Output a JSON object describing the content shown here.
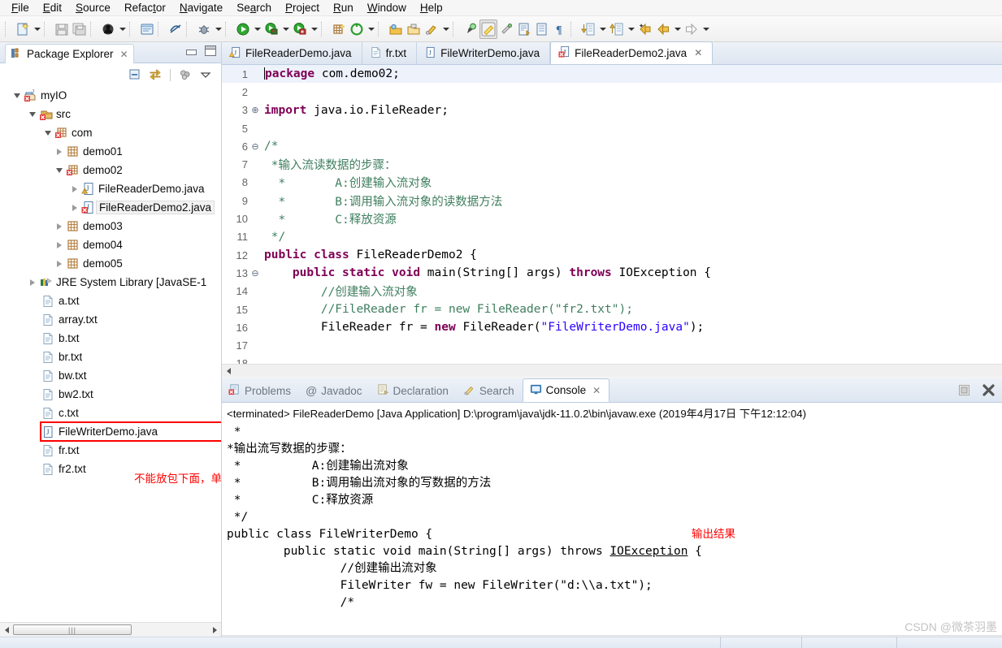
{
  "menubar": {
    "items": [
      {
        "label": "File",
        "mnemonic": "F"
      },
      {
        "label": "Edit",
        "mnemonic": "E"
      },
      {
        "label": "Source",
        "mnemonic": "S"
      },
      {
        "label": "Refactor",
        "mnemonic": "t"
      },
      {
        "label": "Navigate",
        "mnemonic": "N"
      },
      {
        "label": "Search",
        "mnemonic": "a"
      },
      {
        "label": "Project",
        "mnemonic": "P"
      },
      {
        "label": "Run",
        "mnemonic": "R"
      },
      {
        "label": "Window",
        "mnemonic": "W"
      },
      {
        "label": "Help",
        "mnemonic": "H"
      }
    ]
  },
  "toolbar": {
    "icons": [
      "new-wizard-icon",
      "save-icon",
      "save-all-icon",
      "print-icon",
      "new-java-class-icon",
      "toggle-mark-occurrences-icon",
      "debug-icon",
      "run-icon",
      "run-last-tool-icon",
      "coverage-icon",
      "new-java-project-icon",
      "external-tools-icon",
      "open-type-icon",
      "open-task-icon",
      "link-icon",
      "search-icon",
      "highlight-icon",
      "annotation-icon",
      "next-annotation-icon",
      "previous-annotation-icon",
      "pilcrow-icon",
      "next-edit-icon",
      "previous-edit-icon",
      "back-icon",
      "back-history-icon",
      "forward-icon"
    ]
  },
  "package_explorer": {
    "title": "Package Explorer",
    "close_glyph": "✕",
    "toolbar_icons": [
      "collapse-all-icon",
      "link-with-editor-icon",
      "view-menu-icon",
      "chevron-down-icon"
    ],
    "tree": [
      {
        "label": "myIO",
        "depth": 0,
        "twist": "open",
        "icon": "java-project-error-icon"
      },
      {
        "label": "src",
        "depth": 1,
        "twist": "open",
        "icon": "source-folder-error-icon"
      },
      {
        "label": "com",
        "depth": 2,
        "twist": "open",
        "icon": "package-error-icon"
      },
      {
        "label": "demo01",
        "depth": 3,
        "twist": "closed",
        "icon": "package-icon"
      },
      {
        "label": "demo02",
        "depth": 3,
        "twist": "open",
        "icon": "package-error-icon"
      },
      {
        "label": "FileReaderDemo.java",
        "depth": 4,
        "twist": "closed",
        "icon": "java-file-warning-icon"
      },
      {
        "label": "FileReaderDemo2.java",
        "depth": 4,
        "twist": "closed",
        "icon": "java-file-error-icon",
        "selected": true
      },
      {
        "label": "demo03",
        "depth": 3,
        "twist": "closed",
        "icon": "package-icon"
      },
      {
        "label": "demo04",
        "depth": 3,
        "twist": "closed",
        "icon": "package-icon"
      },
      {
        "label": "demo05",
        "depth": 3,
        "twist": "closed",
        "icon": "package-icon"
      },
      {
        "label": "JRE System Library [JavaSE-1",
        "depth": 1,
        "twist": "closed",
        "icon": "jre-library-icon"
      },
      {
        "label": "a.txt",
        "depth": 2,
        "twist": "none",
        "icon": "text-file-icon"
      },
      {
        "label": "array.txt",
        "depth": 2,
        "twist": "none",
        "icon": "text-file-icon"
      },
      {
        "label": "b.txt",
        "depth": 2,
        "twist": "none",
        "icon": "text-file-icon"
      },
      {
        "label": "br.txt",
        "depth": 2,
        "twist": "none",
        "icon": "text-file-icon"
      },
      {
        "label": "bw.txt",
        "depth": 2,
        "twist": "none",
        "icon": "text-file-icon"
      },
      {
        "label": "bw2.txt",
        "depth": 2,
        "twist": "none",
        "icon": "text-file-icon"
      },
      {
        "label": "c.txt",
        "depth": 2,
        "twist": "none",
        "icon": "text-file-icon"
      },
      {
        "label": "FileWriterDemo.java",
        "depth": 2,
        "twist": "none",
        "icon": "java-file-icon",
        "highlight_box": true
      },
      {
        "label": "fr.txt",
        "depth": 2,
        "twist": "none",
        "icon": "text-file-icon"
      },
      {
        "label": "fr2.txt",
        "depth": 2,
        "twist": "none",
        "icon": "text-file-icon"
      }
    ],
    "annotation": "不能放包下面，单独放出来"
  },
  "editor": {
    "tabs": [
      {
        "label": "FileReaderDemo.java",
        "icon": "java-file-warning-icon",
        "active": false
      },
      {
        "label": "fr.txt",
        "icon": "text-file-icon",
        "active": false
      },
      {
        "label": "FileWriterDemo.java",
        "icon": "java-file-icon",
        "active": false
      },
      {
        "label": "FileReaderDemo2.java",
        "icon": "java-file-error-icon",
        "active": true,
        "close_glyph": "✕"
      }
    ],
    "lines": [
      {
        "num": "1",
        "fold": "",
        "text": "package com.demo02;",
        "highlight": true,
        "cursor": true
      },
      {
        "num": "2",
        "fold": "",
        "text": ""
      },
      {
        "num": "3",
        "fold": "⊕",
        "text": "import java.io.FileReader;"
      },
      {
        "num": "5",
        "fold": "",
        "text": ""
      },
      {
        "num": "6",
        "fold": "⊖",
        "text": "/*"
      },
      {
        "num": "7",
        "fold": "",
        "text": " *输入流读数据的步骤："
      },
      {
        "num": "8",
        "fold": "",
        "text": "  *       A:创建输入流对象"
      },
      {
        "num": "9",
        "fold": "",
        "text": "  *       B:调用输入流对象的读数据方法"
      },
      {
        "num": "10",
        "fold": "",
        "text": "  *       C:释放资源"
      },
      {
        "num": "11",
        "fold": "",
        "text": " */"
      },
      {
        "num": "12",
        "fold": "",
        "text": "public class FileReaderDemo2 {"
      },
      {
        "num": "13",
        "fold": "⊖",
        "text": "    public static void main(String[] args) throws IOException {"
      },
      {
        "num": "14",
        "fold": "",
        "text": "        //创建输入流对象"
      },
      {
        "num": "15",
        "fold": "",
        "text": "        //FileReader fr = new FileReader(\"fr2.txt\");"
      },
      {
        "num": "16",
        "fold": "",
        "text": "        FileReader fr = new FileReader(\"FileWriterDemo.java\");"
      },
      {
        "num": "17",
        "fold": "",
        "text": ""
      },
      {
        "num": "18",
        "fold": "",
        "text": ""
      }
    ]
  },
  "console_panel": {
    "tabs": [
      {
        "label": "Problems",
        "icon": "problems-icon",
        "active": false
      },
      {
        "label": "Javadoc",
        "icon": "javadoc-at-icon",
        "active": false
      },
      {
        "label": "Declaration",
        "icon": "declaration-icon",
        "active": false
      },
      {
        "label": "Search",
        "icon": "search-pin-icon",
        "active": false
      },
      {
        "label": "Console",
        "icon": "console-icon",
        "active": true,
        "close_glyph": "✕"
      }
    ],
    "tools": [
      "minimize-icon",
      "close-icon"
    ],
    "terminated_line": "<terminated> FileReaderDemo [Java Application] D:\\program\\java\\jdk-11.0.2\\bin\\javaw.exe (2019年4月17日 下午12:12:04)",
    "output_lines": [
      " *",
      "*输出流写数据的步骤：",
      " *          A:创建输出流对象",
      " *          B:调用输出流对象的写数据的方法",
      " *          C:释放资源",
      " */",
      "public class FileWriterDemo {",
      "        public static void main(String[] args) throws IOException {",
      "                //创建输出流对象",
      "                FileWriter fw = new FileWriter(\"d:\\\\a.txt\");",
      "                /*"
    ],
    "annotation": "输出结果"
  },
  "watermark": "CSDN @微茶羽墨",
  "colors": {
    "accent_blue": "#2a00ff",
    "keyword_purple": "#7f0055",
    "comment_green": "#3f7f5f",
    "annotation_red": "#ff0000",
    "tab_gradient_top": "#eef2f8",
    "tab_gradient_bottom": "#dde6f1"
  }
}
